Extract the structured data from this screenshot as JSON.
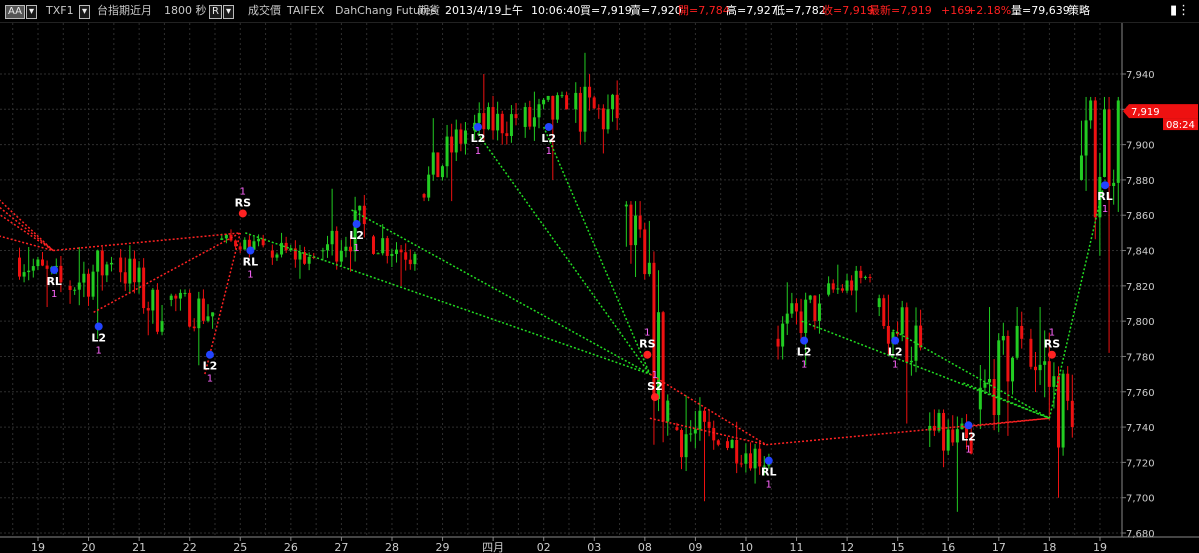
{
  "toolbar": {
    "aa_button": "AA",
    "symbol": "TXF1",
    "symbol_name": "台指期近月",
    "interval": "1800 秒",
    "r_button": "R",
    "price_type": "成交價",
    "source": "TAIFEX",
    "vendor": "DahChang Futures",
    "market": "期貨",
    "date": "2013/4/19",
    "session": "上午",
    "time": "10:06:40",
    "bid": "買=7,919",
    "ask": "賣=7,920",
    "open": "開=7,784",
    "high": "高=7,927",
    "low": "低=7,782",
    "close": "收=7,919",
    "last": "最新=7,919",
    "change": "+169",
    "change_pct": "+2.18%",
    "volume": "量=79,639",
    "strategy": "策略",
    "menu_icon": "menu-icon"
  },
  "colors": {
    "up": "#22cc22",
    "down": "#ee1111",
    "grid": "#2e2e2e",
    "axis_text": "#cccccc",
    "signal_red": "#ff2222",
    "signal_blue": "#2244ff",
    "line_red": "#ff2222",
    "line_green": "#22dd22",
    "label_white": "#ffffff",
    "label_pink": "#ff66ff",
    "price_box": "#ee1111"
  },
  "chart_data": {
    "type": "candlestick",
    "ylim": [
      7680,
      7950
    ],
    "y_ticks": [
      7680,
      7700,
      7720,
      7740,
      7760,
      7780,
      7800,
      7820,
      7840,
      7860,
      7880,
      7900,
      7920,
      7940
    ],
    "y_tick_labels": [
      "7,680",
      "7,700",
      "7,720",
      "7,740",
      "7,760",
      "7,780",
      "7,800",
      "7,820",
      "7,840",
      "7,860",
      "7,880",
      "7,900",
      "7,920",
      "7,940"
    ],
    "x_labels": [
      "19",
      "20",
      "21",
      "22",
      "25",
      "26",
      "27",
      "28",
      "29",
      "四月",
      "02",
      "03",
      "08",
      "09",
      "10",
      "11",
      "12",
      "15",
      "16",
      "17",
      "18",
      "19"
    ],
    "current_price_label": "7,919",
    "countdown_label": "08:24",
    "day_series": [
      {
        "open": 7836,
        "close": 7822,
        "high": 7842,
        "low": 7808
      },
      {
        "open": 7820,
        "close": 7833,
        "high": 7842,
        "low": 7790
      },
      {
        "open": 7836,
        "close": 7800,
        "high": 7843,
        "low": 7792
      },
      {
        "open": 7812,
        "close": 7805,
        "high": 7818,
        "low": 7775
      },
      {
        "open": 7846,
        "close": 7843,
        "high": 7852,
        "low": 7836
      },
      {
        "open": 7840,
        "close": 7836,
        "high": 7850,
        "low": 7824
      },
      {
        "open": 7840,
        "close": 7855,
        "high": 7875,
        "low": 7828
      },
      {
        "open": 7848,
        "close": 7838,
        "high": 7855,
        "low": 7820
      },
      {
        "open": 7872,
        "close": 7908,
        "high": 7915,
        "low": 7868
      },
      {
        "open": 7908,
        "close": 7915,
        "high": 7940,
        "low": 7900
      },
      {
        "open": 7910,
        "close": 7920,
        "high": 7930,
        "low": 7880
      },
      {
        "open": 7920,
        "close": 7915,
        "high": 7952,
        "low": 7895
      },
      {
        "open": 7865,
        "close": 7755,
        "high": 7868,
        "low": 7730
      },
      {
        "open": 7740,
        "close": 7730,
        "high": 7758,
        "low": 7698
      },
      {
        "open": 7732,
        "close": 7722,
        "high": 7743,
        "low": 7708
      },
      {
        "open": 7790,
        "close": 7810,
        "high": 7822,
        "low": 7775
      },
      {
        "open": 7815,
        "close": 7825,
        "high": 7832,
        "low": 7805
      },
      {
        "open": 7808,
        "close": 7785,
        "high": 7815,
        "low": 7742
      },
      {
        "open": 7738,
        "close": 7725,
        "high": 7750,
        "low": 7692
      },
      {
        "open": 7750,
        "close": 7790,
        "high": 7808,
        "low": 7735
      },
      {
        "open": 7790,
        "close": 7740,
        "high": 7808,
        "low": 7700
      },
      {
        "open": 7880,
        "close": 7919,
        "high": 7927,
        "low": 7782
      }
    ],
    "signals": [
      {
        "label": "RL",
        "count": "1",
        "day": 0.32,
        "price": 7829,
        "color": "blue",
        "below": true
      },
      {
        "label": "L2",
        "count": "1",
        "day": 1.2,
        "price": 7797,
        "color": "blue",
        "below": true
      },
      {
        "label": "L2",
        "count": "1",
        "day": 3.4,
        "price": 7781,
        "color": "blue",
        "below": true
      },
      {
        "label": "RS",
        "count": "1",
        "day": 4.05,
        "price": 7861,
        "color": "red",
        "below": false
      },
      {
        "label": "RL",
        "count": "1",
        "day": 4.2,
        "price": 7840,
        "color": "blue",
        "below": true
      },
      {
        "label": "L2",
        "count": "1",
        "day": 6.3,
        "price": 7855,
        "color": "blue",
        "below": true
      },
      {
        "label": "L2",
        "count": "1",
        "day": 8.7,
        "price": 7910,
        "color": "blue",
        "below": true
      },
      {
        "label": "L2",
        "count": "1",
        "day": 10.1,
        "price": 7910,
        "color": "blue",
        "below": true
      },
      {
        "label": "RS",
        "count": "1",
        "day": 12.05,
        "price": 7781,
        "color": "red",
        "below": false
      },
      {
        "label": "S2",
        "count": "1",
        "day": 12.2,
        "price": 7757,
        "color": "red",
        "below": false
      },
      {
        "label": "RL",
        "count": "1",
        "day": 14.45,
        "price": 7721,
        "color": "blue",
        "below": true
      },
      {
        "label": "L2",
        "count": "1",
        "day": 15.15,
        "price": 7789,
        "color": "blue",
        "below": true
      },
      {
        "label": "L2",
        "count": "1",
        "day": 16.95,
        "price": 7789,
        "color": "blue",
        "below": true
      },
      {
        "label": "L2",
        "count": "1",
        "day": 18.4,
        "price": 7741,
        "color": "blue",
        "below": true
      },
      {
        "label": "RS",
        "count": "1",
        "day": 20.05,
        "price": 7781,
        "color": "red",
        "below": false
      },
      {
        "label": "RL",
        "count": "1",
        "day": 21.1,
        "price": 7877,
        "color": "blue",
        "below": true
      }
    ],
    "connector_lines": [
      {
        "color": "red",
        "from": [
          -1.0,
          7875
        ],
        "to": [
          0.3,
          7840
        ]
      },
      {
        "color": "red",
        "from": [
          -1.0,
          7870
        ],
        "to": [
          0.3,
          7840
        ]
      },
      {
        "color": "red",
        "from": [
          -1.0,
          7865
        ],
        "to": [
          0.3,
          7840
        ]
      },
      {
        "color": "red",
        "from": [
          -1.0,
          7850
        ],
        "to": [
          0.3,
          7840
        ]
      },
      {
        "color": "red",
        "from": [
          0.3,
          7840
        ],
        "to": [
          4.0,
          7850
        ]
      },
      {
        "color": "red",
        "from": [
          1.1,
          7805
        ],
        "to": [
          4.0,
          7850
        ]
      },
      {
        "color": "red",
        "from": [
          3.3,
          7770
        ],
        "to": [
          4.0,
          7850
        ]
      },
      {
        "color": "green",
        "from": [
          4.1,
          7850
        ],
        "to": [
          12.1,
          7770
        ]
      },
      {
        "color": "green",
        "from": [
          6.2,
          7863
        ],
        "to": [
          12.1,
          7770
        ]
      },
      {
        "color": "green",
        "from": [
          8.6,
          7910
        ],
        "to": [
          12.1,
          7770
        ]
      },
      {
        "color": "green",
        "from": [
          10.0,
          7910
        ],
        "to": [
          12.1,
          7770
        ]
      },
      {
        "color": "red",
        "from": [
          12.1,
          7770
        ],
        "to": [
          14.4,
          7730
        ]
      },
      {
        "color": "red",
        "from": [
          12.1,
          7745
        ],
        "to": [
          14.4,
          7730
        ]
      },
      {
        "color": "red",
        "from": [
          14.4,
          7730
        ],
        "to": [
          20.0,
          7745
        ]
      },
      {
        "color": "red",
        "from": [
          18.3,
          7740
        ],
        "to": [
          20.0,
          7745
        ]
      },
      {
        "color": "green",
        "from": [
          15.1,
          7800
        ],
        "to": [
          20.0,
          7745
        ]
      },
      {
        "color": "green",
        "from": [
          16.9,
          7795
        ],
        "to": [
          20.0,
          7745
        ]
      },
      {
        "color": "green",
        "from": [
          18.3,
          7765
        ],
        "to": [
          20.0,
          7745
        ]
      },
      {
        "color": "green",
        "from": [
          20.0,
          7745
        ],
        "to": [
          21.1,
          7880
        ]
      }
    ]
  }
}
